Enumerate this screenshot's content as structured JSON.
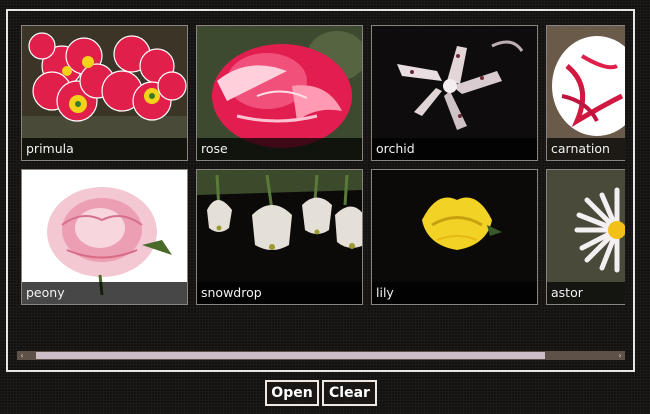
{
  "gallery": {
    "items": [
      {
        "label": "primula"
      },
      {
        "label": "rose"
      },
      {
        "label": "orchid"
      },
      {
        "label": "carnation"
      },
      {
        "label": "peony"
      },
      {
        "label": "snowdrop"
      },
      {
        "label": "lily"
      },
      {
        "label": "astor"
      }
    ]
  },
  "actions": {
    "open_label": "Open",
    "clear_label": "Clear"
  }
}
